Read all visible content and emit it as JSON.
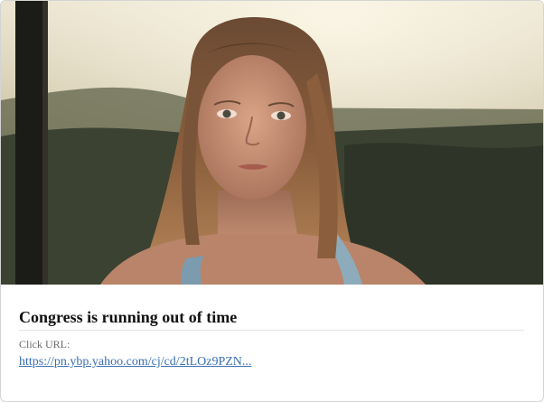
{
  "card": {
    "image_description_name": "portrait-photo",
    "title": "Congress is running out of time",
    "click_url_label": "Click URL:",
    "click_url_text": "https://pn.ybp.yahoo.com/cj/cd/2tLOz9PZN...",
    "link_color": "#3b6fb6"
  }
}
